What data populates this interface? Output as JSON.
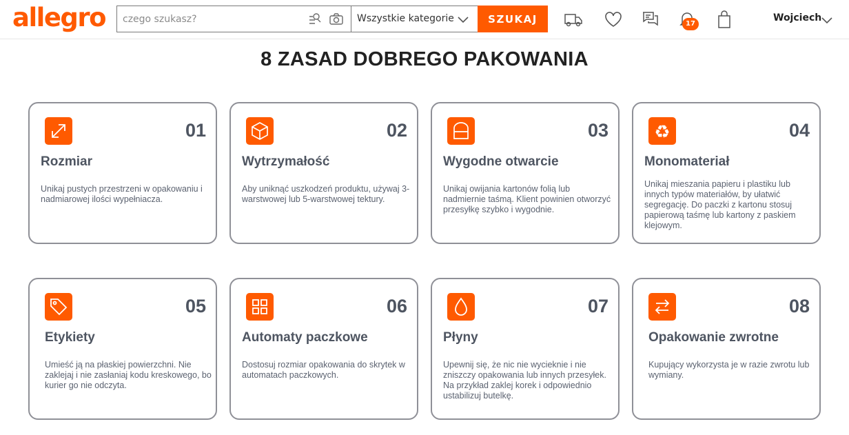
{
  "header": {
    "logo": "allegro",
    "search_placeholder": "czego szukasz?",
    "category": "Wszystkie kategorie",
    "search_button": "SZUKAJ",
    "notifications_count": "17",
    "user_name": "Wojciech"
  },
  "page_title": "8 ZASAD DOBREGO PAKOWANIA",
  "cards": [
    {
      "num": "01",
      "title": "Rozmiar",
      "desc": "Unikaj pustych przestrzeni w opakowaniu i nadmiarowej ilości wypełniacza.",
      "icon": "resize-arrows-icon"
    },
    {
      "num": "02",
      "title": "Wytrzymałość",
      "desc": "Aby uniknąć uszkodzeń produktu, używaj 3-warstwowej lub 5-warstwowej tektury.",
      "icon": "box-icon"
    },
    {
      "num": "03",
      "title": "Wygodne otwarcie",
      "desc": "Unikaj owijania kartonów folią lub nadmiernie taśmą. Klient powinien otworzyć przesyłkę szybko i wygodnie.",
      "icon": "open-box-icon"
    },
    {
      "num": "04",
      "title": "Monomateriał",
      "desc": "Unikaj mieszania papieru i plastiku lub innych typów materiałów, by ułatwić segregację. Do paczki z kartonu stosuj papierową taśmę lub kartony z paskiem klejowym.",
      "icon": "recycle-icon"
    },
    {
      "num": "05",
      "title": "Etykiety",
      "desc": "Umieść ją na płaskiej powierzchni. Nie zaklejaj i nie zasłaniaj kodu kreskowego, bo kurier go nie odczyta.",
      "icon": "label-tag-icon"
    },
    {
      "num": "06",
      "title": "Automaty paczkowe",
      "desc": "Dostosuj rozmiar opakowania do skrytek w automatach paczkowych.",
      "icon": "parcel-locker-icon"
    },
    {
      "num": "07",
      "title": "Płyny",
      "desc": "Upewnij się, że nic nie wycieknie i nie zniszczy opakowania lub innych przesyłek. Na przykład zaklej korek i odpowiednio ustabilizuj butelkę.",
      "icon": "liquid-drop-icon"
    },
    {
      "num": "08",
      "title": "Opakowanie zwrotne",
      "desc": "Kupujący wykorzysta je w razie zwrotu lub wymiany.",
      "icon": "return-arrows-icon"
    }
  ],
  "colors": {
    "accent": "#ff5a00",
    "card_border": "#8f9097",
    "card_text": "#4e5561"
  }
}
